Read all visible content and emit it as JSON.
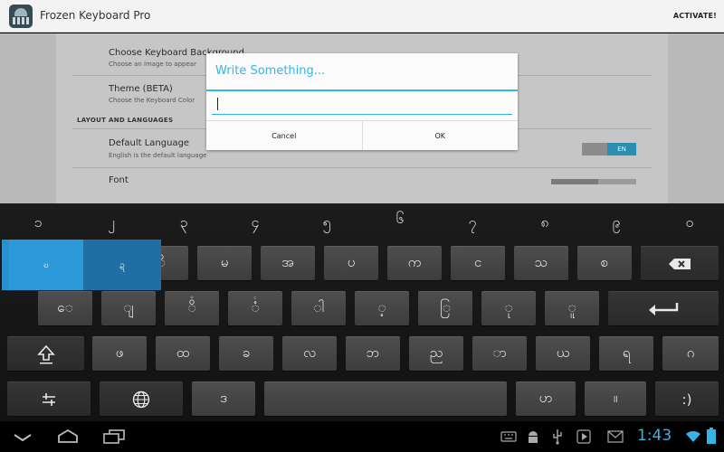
{
  "app": {
    "title": "Frozen Keyboard Pro",
    "activate_label": "ACTIVATE!"
  },
  "settings": {
    "bg_title": "Choose Keyboard Background",
    "bg_sub": "Choose an image to appear",
    "theme_title": "Theme (BETA)",
    "theme_sub": "Choose the Keyboard Color",
    "section_header": "LAYOUT AND LANGUAGES",
    "lang_title": "Default Language",
    "lang_sub": "English is the default language",
    "lang_toggle": "EN",
    "font_title": "Font"
  },
  "dialog": {
    "title": "Write Something...",
    "input_value": "",
    "cancel_label": "Cancel",
    "ok_label": "OK"
  },
  "keyboard": {
    "numbers": [
      "၁",
      "၂",
      "၃",
      "၄",
      "၅",
      "၆",
      "၇",
      "၈",
      "၉",
      "၀"
    ],
    "row1": [
      "ေ",
      "ျ",
      "ိ",
      "မ",
      "အ",
      "ပ",
      "က",
      "င",
      "သ",
      "စ"
    ],
    "row2": [
      "ေ",
      "ျ",
      "ိ",
      "ံ",
      "ါ",
      "့",
      "ြ",
      "ု",
      "ူ"
    ],
    "row2_hints": [
      "",
      "",
      "°",
      "ᶜ",
      "",
      "",
      "",
      "",
      ""
    ],
    "row3": [
      "ဖ",
      "ထ",
      "ခ",
      "လ",
      "ဘ",
      "ည",
      "ာ",
      "ယ",
      "ရ",
      "ဂ"
    ],
    "row4": [
      "ဒ",
      "ဟ",
      "။",
      ":)"
    ],
    "popup": [
      "ဎ",
      "ဍ"
    ]
  },
  "colors": {
    "accent": "#33b5e5",
    "key": "#474747",
    "keyboard_bg": "#171717"
  },
  "icons": {
    "backspace": "backspace-icon",
    "enter": "enter-icon",
    "shift": "shift-icon",
    "settings": "sliders-icon",
    "globe": "globe-icon"
  },
  "status": {
    "time": "1:43"
  }
}
